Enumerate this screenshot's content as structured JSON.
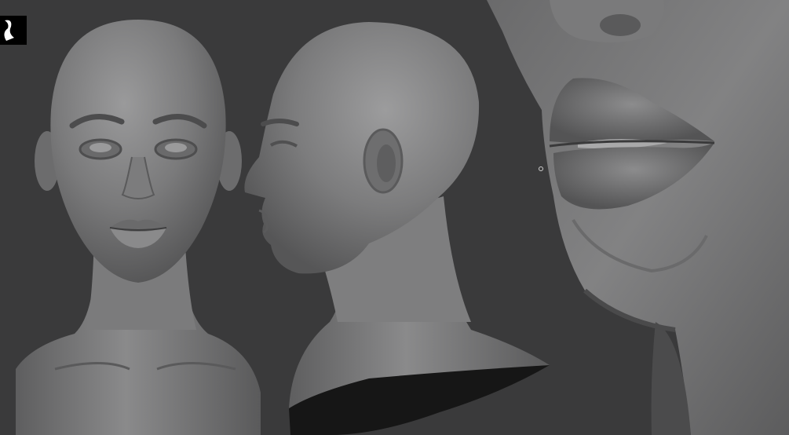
{
  "scene": {
    "logo_icon": "zbrush-logo-icon",
    "palette": {
      "background": "#3a3a3b",
      "clay_light": "#8f8f90",
      "clay_mid": "#6f6f70",
      "clay_dark": "#4a4a4b",
      "shadow": "#161616"
    }
  }
}
